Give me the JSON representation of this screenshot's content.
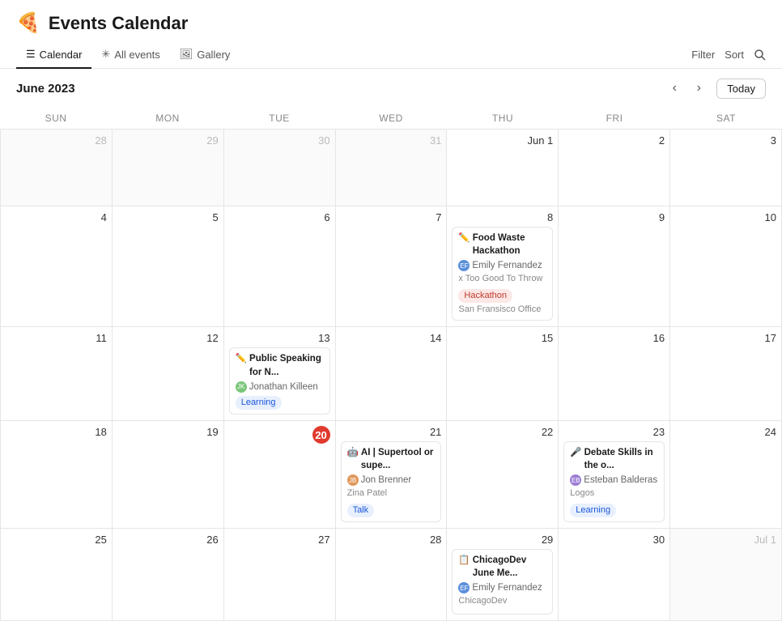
{
  "app": {
    "icon": "🍕",
    "title": "Events Calendar"
  },
  "nav": {
    "tabs": [
      {
        "id": "calendar",
        "icon": "☰",
        "label": "Calendar",
        "active": true
      },
      {
        "id": "all-events",
        "icon": "✳",
        "label": "All events",
        "active": false
      },
      {
        "id": "gallery",
        "icon": "🖼",
        "label": "Gallery",
        "active": false
      }
    ]
  },
  "toolbar": {
    "month_label": "June 2023",
    "filter_label": "Filter",
    "sort_label": "Sort",
    "today_label": "Today"
  },
  "day_headers": [
    "Sun",
    "Mon",
    "Tue",
    "Wed",
    "Thu",
    "Fri",
    "Sat"
  ],
  "calendar": {
    "weeks": [
      {
        "days": [
          {
            "date": 28,
            "month": "prev",
            "events": []
          },
          {
            "date": 29,
            "month": "prev",
            "events": []
          },
          {
            "date": 30,
            "month": "prev",
            "events": []
          },
          {
            "date": 31,
            "month": "prev",
            "events": []
          },
          {
            "date": 1,
            "month": "current",
            "label": "Jun 1",
            "events": []
          },
          {
            "date": 2,
            "month": "current",
            "events": []
          },
          {
            "date": 3,
            "month": "current",
            "events": []
          }
        ]
      },
      {
        "days": [
          {
            "date": 4,
            "month": "current",
            "events": []
          },
          {
            "date": 5,
            "month": "current",
            "events": []
          },
          {
            "date": 6,
            "month": "current",
            "events": []
          },
          {
            "date": 7,
            "month": "current",
            "events": []
          },
          {
            "date": 8,
            "month": "current",
            "events": [
              {
                "id": "e1",
                "icon": "✏️",
                "title": "Food Waste Hackathon",
                "person": "Emily Fernandez",
                "person_avatar": "ef",
                "org": "x Too Good To Throw",
                "tag": "Hackathon",
                "tag_style": "hackathon",
                "location": "San Fransisco Office"
              }
            ]
          },
          {
            "date": 9,
            "month": "current",
            "events": []
          },
          {
            "date": 10,
            "month": "current",
            "events": []
          }
        ]
      },
      {
        "days": [
          {
            "date": 11,
            "month": "current",
            "events": []
          },
          {
            "date": 12,
            "month": "current",
            "events": []
          },
          {
            "date": 13,
            "month": "current",
            "events": [
              {
                "id": "e2",
                "icon": "✏️",
                "title": "Public Speaking for N...",
                "person": "Jonathan Killeen",
                "person_avatar": "jk",
                "org": "",
                "tag": "Learning",
                "tag_style": "learning",
                "location": ""
              }
            ]
          },
          {
            "date": 14,
            "month": "current",
            "events": []
          },
          {
            "date": 15,
            "month": "current",
            "events": []
          },
          {
            "date": 16,
            "month": "current",
            "events": []
          },
          {
            "date": 17,
            "month": "current",
            "events": []
          }
        ]
      },
      {
        "days": [
          {
            "date": 18,
            "month": "current",
            "events": []
          },
          {
            "date": 19,
            "month": "current",
            "events": []
          },
          {
            "date": 20,
            "month": "current",
            "today": true,
            "events": []
          },
          {
            "date": 21,
            "month": "current",
            "events": [
              {
                "id": "e3",
                "icon": "🤖",
                "title": "AI | Supertool or supe...",
                "person": "Jon Brenner",
                "person_avatar": "jb",
                "person2": "Zina Patel",
                "org": "",
                "tag": "Talk",
                "tag_style": "talk",
                "location": ""
              }
            ]
          },
          {
            "date": 22,
            "month": "current",
            "events": []
          },
          {
            "date": 23,
            "month": "current",
            "events": [
              {
                "id": "e4",
                "icon": "🎤",
                "title": "Debate Skills in the o...",
                "person": "Esteban Balderas",
                "person_avatar": "eb",
                "org": "Logos",
                "tag": "Learning",
                "tag_style": "learning",
                "location": ""
              }
            ]
          },
          {
            "date": 24,
            "month": "current",
            "events": []
          }
        ]
      },
      {
        "days": [
          {
            "date": 25,
            "month": "current",
            "events": []
          },
          {
            "date": 26,
            "month": "current",
            "events": []
          },
          {
            "date": 27,
            "month": "current",
            "events": []
          },
          {
            "date": 28,
            "month": "current",
            "events": []
          },
          {
            "date": 29,
            "month": "current",
            "events": [
              {
                "id": "e5",
                "icon": "📋",
                "title": "ChicagoDev June Me...",
                "person": "Emily Fernandez",
                "person_avatar": "emf",
                "org": "ChicagoDev",
                "tag": "",
                "tag_style": "",
                "location": ""
              }
            ]
          },
          {
            "date": 30,
            "month": "current",
            "events": []
          },
          {
            "date": 1,
            "month": "next",
            "label": "Jul 1",
            "events": []
          }
        ]
      }
    ]
  }
}
